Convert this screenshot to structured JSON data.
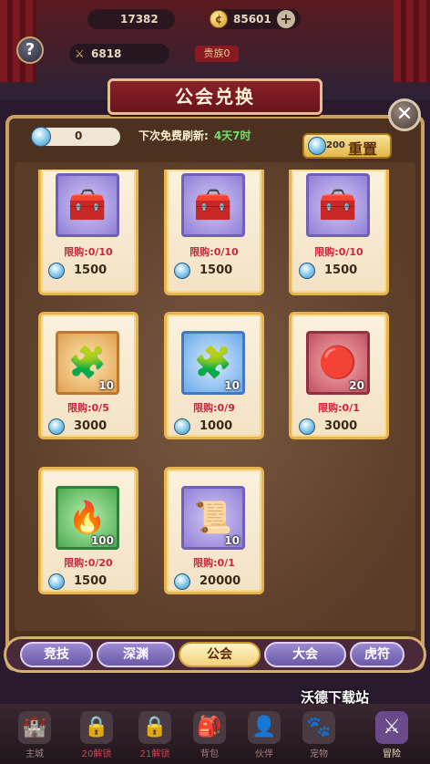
{
  "hud": {
    "power_value": "17382",
    "gold_value": "85601",
    "gold_plus": "+",
    "help_label": "?",
    "sword_value": "6818",
    "rank_label": "贵族0"
  },
  "title": "公会兑换",
  "close_label": "✕",
  "currency": {
    "value": "0",
    "icon": "diamond-icon"
  },
  "refresh": {
    "label": "下次免费刷新:",
    "time": "4天7时"
  },
  "reset_button": {
    "cost": "200",
    "label": "重置"
  },
  "items": [
    {
      "name": "silver-chest",
      "icon": "winged-chest-icon",
      "qty": "",
      "limit": "限购:0/10",
      "price": "1500"
    },
    {
      "name": "silver-chest",
      "icon": "winged-chest-icon",
      "qty": "",
      "limit": "限购:0/10",
      "price": "1500"
    },
    {
      "name": "silver-chest",
      "icon": "winged-chest-icon",
      "qty": "",
      "limit": "限购:0/10",
      "price": "1500"
    },
    {
      "name": "gold-puzzle",
      "icon": "gold-puzzle-icon",
      "qty": "10",
      "limit": "限购:0/5",
      "price": "3000"
    },
    {
      "name": "blue-puzzle",
      "icon": "blue-puzzle-icon",
      "qty": "10",
      "limit": "限购:0/9",
      "price": "1000"
    },
    {
      "name": "red-gem",
      "icon": "red-gem-icon",
      "qty": "20",
      "limit": "限购:0/1",
      "price": "3000"
    },
    {
      "name": "fire-crystal",
      "icon": "fire-crystal-icon",
      "qty": "100",
      "limit": "限购:0/20",
      "price": "1500"
    },
    {
      "name": "scroll",
      "icon": "scroll-icon",
      "qty": "10",
      "limit": "限购:0/1",
      "price": "20000"
    }
  ],
  "tabs": [
    {
      "label": "竞技",
      "active": false
    },
    {
      "label": "深渊",
      "active": false
    },
    {
      "label": "公会",
      "active": true
    },
    {
      "label": "大会",
      "active": false
    },
    {
      "label": "虎符",
      "active": false
    }
  ],
  "watermark": "沃德下载站",
  "nav": [
    {
      "label": "主城",
      "icon": "castle-icon",
      "locked": false
    },
    {
      "label": "20解锁",
      "icon": "lock-icon",
      "locked": true
    },
    {
      "label": "21解锁",
      "icon": "lock-icon",
      "locked": true
    },
    {
      "label": "背包",
      "icon": "bag-icon",
      "locked": false
    },
    {
      "label": "伙伴",
      "icon": "partner-icon",
      "locked": false
    },
    {
      "label": "宠物",
      "icon": "pet-icon",
      "locked": false
    },
    {
      "label": "冒险",
      "icon": "swords-icon",
      "locked": false,
      "active": true
    }
  ]
}
